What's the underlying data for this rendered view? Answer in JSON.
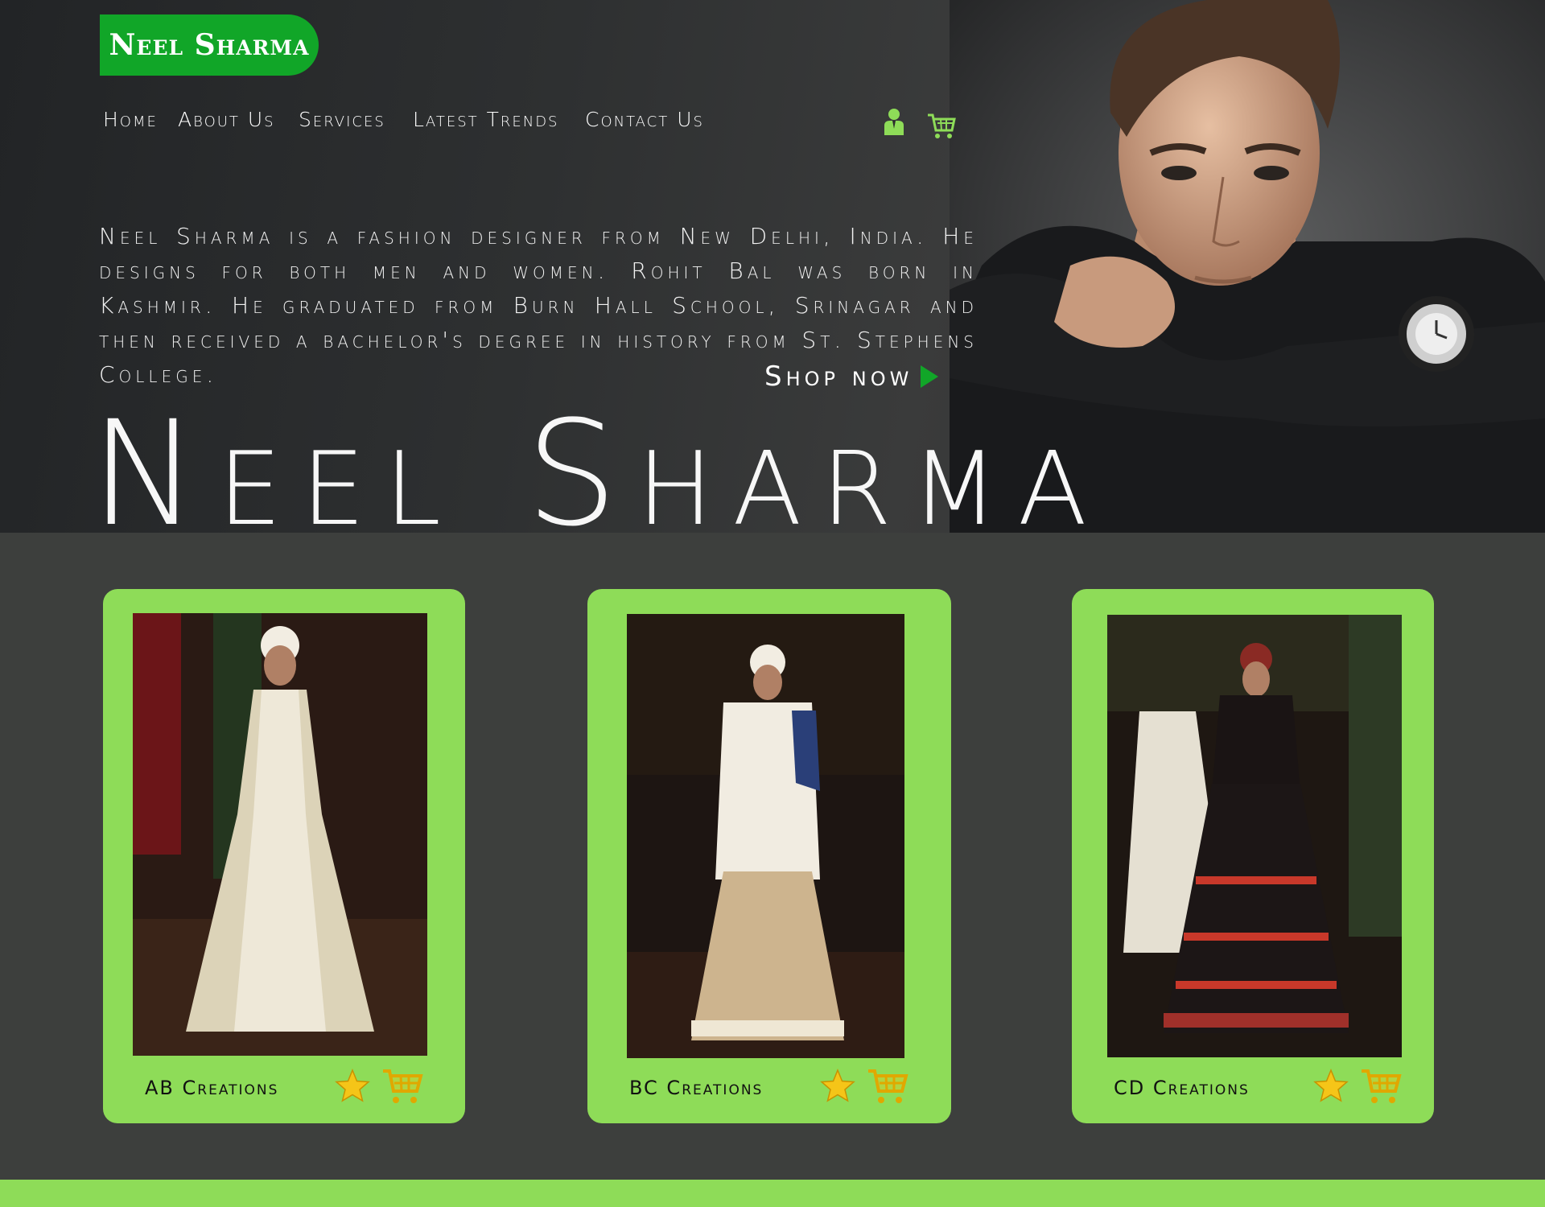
{
  "brand": {
    "logo_text": "Neel Sharma"
  },
  "nav": {
    "items": [
      {
        "label": "Home"
      },
      {
        "label": "About Us"
      },
      {
        "label": "Services"
      },
      {
        "label": "Latest Trends"
      },
      {
        "label": "Contact Us"
      }
    ],
    "icons": [
      "user-icon",
      "cart-icon"
    ]
  },
  "hero": {
    "intro": "Neel Sharma is a fashion designer from New Delhi, India. He designs for both men and women. Rohit Bal was born in Kashmir. He graduated from Burn Hall School, Srinagar and then received a bachelor's degree in history from St. Stephens College.",
    "shop_label": "Shop now",
    "big_title": "Neel Sharma"
  },
  "products": [
    {
      "name": "AB Creations",
      "icons": [
        "star-icon",
        "cart-icon"
      ]
    },
    {
      "name": "BC Creations",
      "icons": [
        "star-icon",
        "cart-icon"
      ]
    },
    {
      "name": "CD Creations",
      "icons": [
        "star-icon",
        "cart-icon"
      ]
    }
  ],
  "colors": {
    "accent_green": "#11a628",
    "card_green": "#8edc58",
    "page_bg": "#3d3f3d",
    "hero_bg": "#2b2c2d"
  }
}
